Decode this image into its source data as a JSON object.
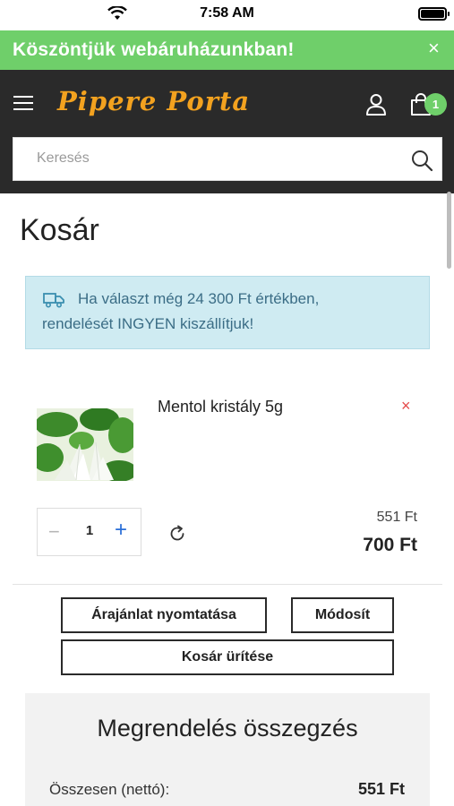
{
  "status_bar": {
    "time": "7:58 AM"
  },
  "welcome_banner": {
    "text": "Köszöntjük webáruházunkban!",
    "close": "×"
  },
  "header": {
    "logo": "Pipere Porta",
    "cart_count": "1",
    "accent_color": "#f3a21f",
    "icons": [
      "menu-icon",
      "user-icon",
      "cart-icon"
    ]
  },
  "search": {
    "placeholder": "Keresés"
  },
  "page": {
    "title": "Kosár"
  },
  "shipping_notice": {
    "line1": "Ha választ még 24 300 Ft értékben,",
    "line2": "rendelését INGYEN kiszállítjuk!"
  },
  "cart": {
    "items": [
      {
        "name": "Mentol kristály 5g",
        "remove": "×",
        "quantity": "1",
        "minus": "−",
        "plus": "+",
        "unit_price": "551 Ft",
        "total": "700 Ft"
      }
    ]
  },
  "actions": {
    "print_quote": "Árajánlat nyomtatása",
    "modify": "Módosít",
    "empty_cart": "Kosár ürítése"
  },
  "summary": {
    "title": "Megrendelés összegzés",
    "rows": [
      {
        "label": "Összesen (nettó):",
        "value": "551 Ft"
      }
    ]
  },
  "colors": {
    "banner_green": "#6fcf6a",
    "header_dark": "#2a2a2a",
    "alert_bg": "#cfebf2",
    "alert_text": "#3b6d86",
    "remove_red": "#e54b4b",
    "plus_blue": "#2a6fd8"
  }
}
